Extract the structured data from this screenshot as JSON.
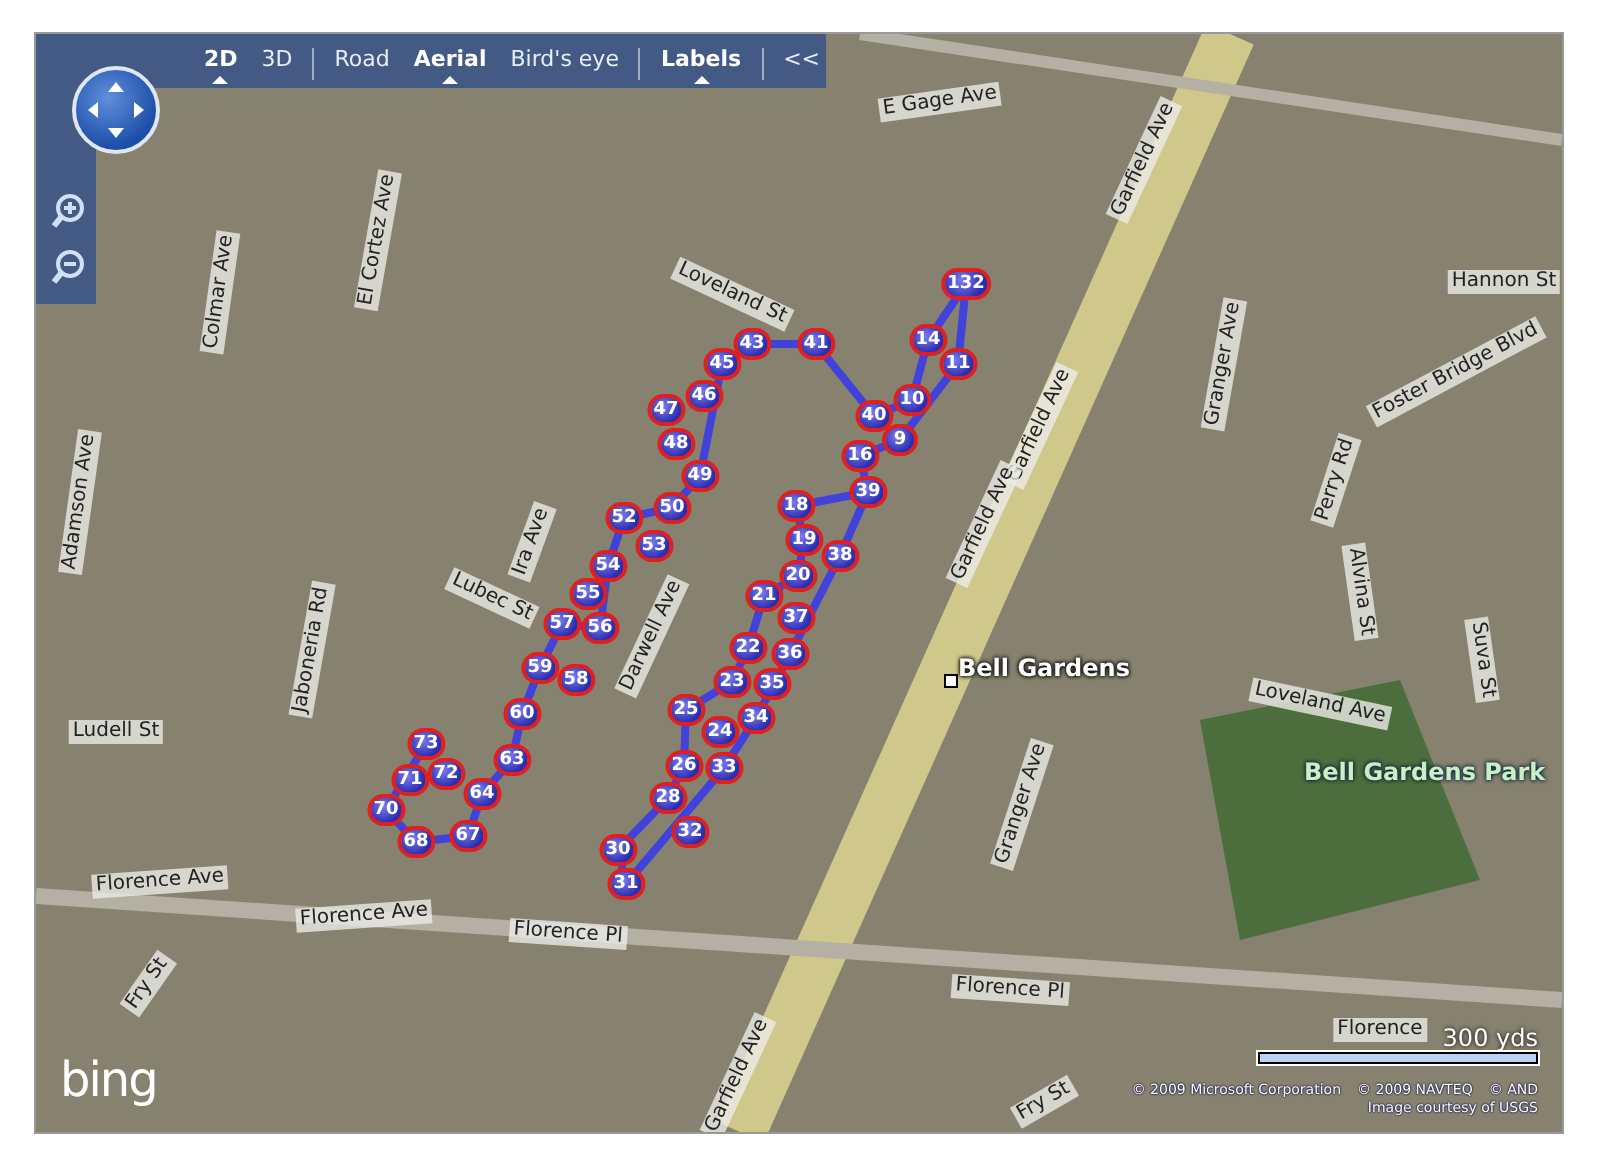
{
  "map_controls": {
    "view_modes": [
      {
        "label": "2D",
        "selected": true
      },
      {
        "label": "3D",
        "selected": false
      }
    ],
    "map_styles": [
      {
        "label": "Road",
        "selected": false
      },
      {
        "label": "Aerial",
        "selected": true
      },
      {
        "label": "Bird's eye",
        "selected": false
      }
    ],
    "labels_toggle": {
      "label": "Labels",
      "selected": true
    },
    "collapse_label": "<<"
  },
  "street_labels": [
    {
      "text": "E Gage Ave"
    },
    {
      "text": "Garfield Ave"
    },
    {
      "text": "Garfield Ave"
    },
    {
      "text": "Garfield Ave"
    },
    {
      "text": "Garfield Ave"
    },
    {
      "text": "Loveland St"
    },
    {
      "text": "Loveland Ave"
    },
    {
      "text": "Hannon St"
    },
    {
      "text": "Foster Bridge Blvd"
    },
    {
      "text": "Perry Rd"
    },
    {
      "text": "Alvina St"
    },
    {
      "text": "Suva St"
    },
    {
      "text": "Granger Ave"
    },
    {
      "text": "Granger Ave"
    },
    {
      "text": "Ludell St"
    },
    {
      "text": "Florence Ave"
    },
    {
      "text": "Florence Ave"
    },
    {
      "text": "Florence Pl"
    },
    {
      "text": "Florence Pl"
    },
    {
      "text": "Florence"
    },
    {
      "text": "Fry St"
    },
    {
      "text": "Fry St"
    },
    {
      "text": "Jaboneria Rd"
    },
    {
      "text": "Lubec St"
    },
    {
      "text": "Ira Ave"
    },
    {
      "text": "Darwell Ave"
    },
    {
      "text": "Adamson Ave"
    },
    {
      "text": "Colmar Ave"
    },
    {
      "text": "El Cortez Ave"
    }
  ],
  "place_labels": [
    {
      "text": "Bell Gardens",
      "kind": "city"
    },
    {
      "text": "Bell Gardens Park",
      "kind": "park"
    }
  ],
  "route_markers": [
    {
      "label": "132"
    },
    {
      "label": "14"
    },
    {
      "label": "11"
    },
    {
      "label": "10"
    },
    {
      "label": "40"
    },
    {
      "label": "9"
    },
    {
      "label": "16"
    },
    {
      "label": "39"
    },
    {
      "label": "18"
    },
    {
      "label": "19"
    },
    {
      "label": "38"
    },
    {
      "label": "20"
    },
    {
      "label": "21"
    },
    {
      "label": "37"
    },
    {
      "label": "22"
    },
    {
      "label": "36"
    },
    {
      "label": "23"
    },
    {
      "label": "35"
    },
    {
      "label": "34"
    },
    {
      "label": "25"
    },
    {
      "label": "24"
    },
    {
      "label": "26"
    },
    {
      "label": "33"
    },
    {
      "label": "28"
    },
    {
      "label": "32"
    },
    {
      "label": "30"
    },
    {
      "label": "31"
    },
    {
      "label": "43"
    },
    {
      "label": "41"
    },
    {
      "label": "45"
    },
    {
      "label": "46"
    },
    {
      "label": "47"
    },
    {
      "label": "48"
    },
    {
      "label": "49"
    },
    {
      "label": "50"
    },
    {
      "label": "52"
    },
    {
      "label": "53"
    },
    {
      "label": "54"
    },
    {
      "label": "55"
    },
    {
      "label": "57"
    },
    {
      "label": "56"
    },
    {
      "label": "59"
    },
    {
      "label": "58"
    },
    {
      "label": "60"
    },
    {
      "label": "63"
    },
    {
      "label": "64"
    },
    {
      "label": "73"
    },
    {
      "label": "71"
    },
    {
      "label": "72"
    },
    {
      "label": "70"
    },
    {
      "label": "68"
    },
    {
      "label": "67"
    }
  ],
  "logo": "bing",
  "scale": {
    "label": "300 yds"
  },
  "attribution": [
    "© 2009 Microsoft Corporation",
    "© 2009 NAVTEQ",
    "© AND"
  ],
  "image_credit": "Image courtesy of USGS"
}
